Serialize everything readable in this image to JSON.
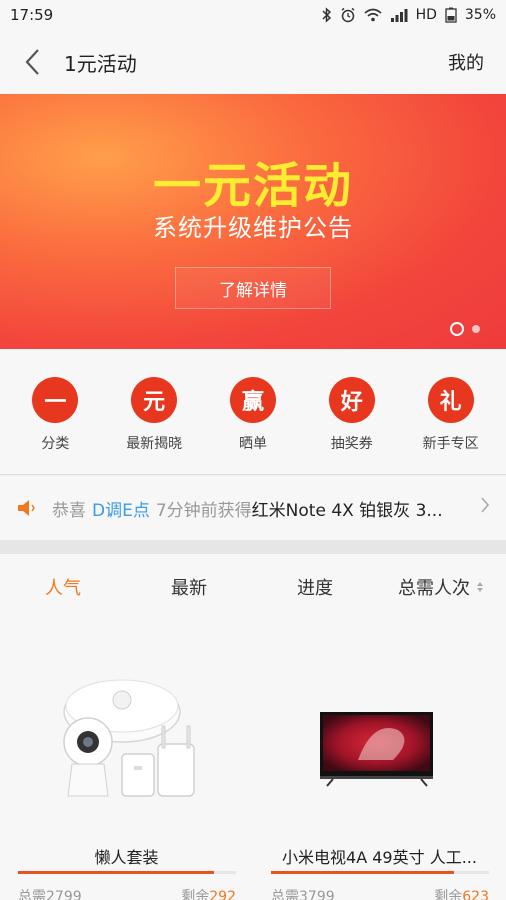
{
  "status_bar": {
    "time": "17:59",
    "network": "HD",
    "battery": "35%"
  },
  "app_bar": {
    "title": "1元活动",
    "my_link": "我的"
  },
  "banner": {
    "title": "一元活动",
    "subtitle": "系统升级维护公告",
    "button_label": "了解详情",
    "page_count": 2,
    "active_page": 1
  },
  "categories": [
    {
      "glyph": "一",
      "label": "分类"
    },
    {
      "glyph": "元",
      "label": "最新揭晓"
    },
    {
      "glyph": "赢",
      "label": "晒单"
    },
    {
      "glyph": "好",
      "label": "抽奖券"
    },
    {
      "glyph": "礼",
      "label": "新手专区"
    }
  ],
  "notice": {
    "icon": "speaker-icon",
    "prefix": "恭喜",
    "user": "D调E点",
    "time_text": "7分钟前获得",
    "prize": "红米Note 4X 铂银灰 3..."
  },
  "sort_tabs": [
    {
      "label": "人气",
      "active": true
    },
    {
      "label": "最新",
      "active": false
    },
    {
      "label": "进度",
      "active": false
    },
    {
      "label": "总需人次",
      "active": false
    }
  ],
  "products": [
    {
      "name": "懒人套装",
      "total": "总需2799",
      "remain_label": "剩余",
      "remain": "292",
      "progress": 0.9
    },
    {
      "name": "小米电视4A 49英寸 人工...",
      "total": "总需3799",
      "remain_label": "剩余",
      "remain": "623",
      "progress": 0.84
    }
  ],
  "colors": {
    "accent": "#f0781f",
    "category": "#e8371f",
    "banner_title": "#ffec33",
    "link_blue": "#3a9be8"
  }
}
